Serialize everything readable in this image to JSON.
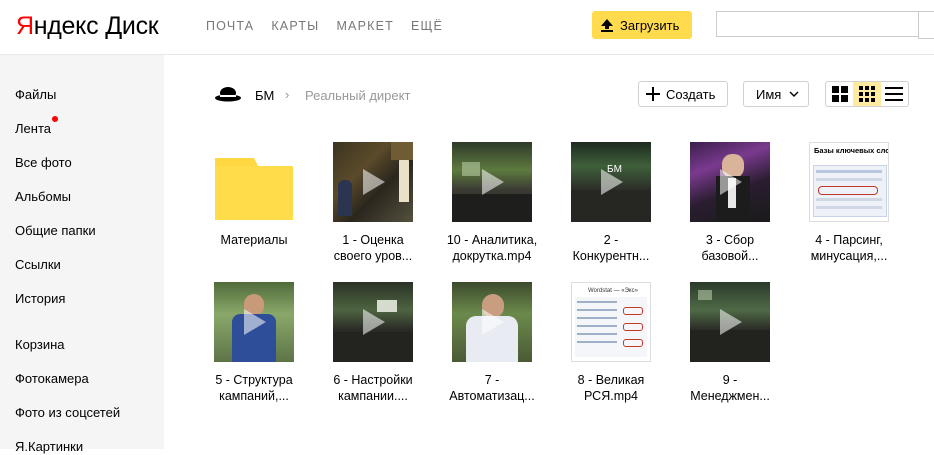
{
  "header": {
    "logo_ya_first": "Я",
    "logo_ya_rest": "ндекс",
    "logo_disk": "Диск",
    "services": [
      "ПОЧТА",
      "КАРТЫ",
      "МАРКЕТ",
      "ЕЩЁ"
    ],
    "upload_label": "Загрузить",
    "search_value": ""
  },
  "sidebar": {
    "items": [
      {
        "label": "Файлы"
      },
      {
        "label": "Лента"
      },
      {
        "label": "Все фото"
      },
      {
        "label": "Альбомы"
      },
      {
        "label": "Общие папки"
      },
      {
        "label": "Ссылки"
      },
      {
        "label": "История"
      },
      {
        "label": "Корзина"
      },
      {
        "label": "Фотокамера"
      },
      {
        "label": "Фото из соцсетей"
      },
      {
        "label": "Я.Картинки"
      }
    ]
  },
  "toolbar": {
    "breadcrumb_root": "БМ",
    "breadcrumb_sep": "›",
    "breadcrumb_current": "Реальный директ",
    "create_label": "Создать",
    "sort_label": "Имя"
  },
  "files": [
    {
      "name": "Материалы",
      "kind": "folder"
    },
    {
      "name": "1 - Оценка\nсвоего уров...",
      "kind": "video"
    },
    {
      "name": "10 - Аналитика,\nдокрутка.mp4",
      "kind": "video"
    },
    {
      "name": "2 -\nКонкурентн...",
      "kind": "video"
    },
    {
      "name": "3 - Сбор\nбазовой...",
      "kind": "video"
    },
    {
      "name": "4 - Парсинг,\nминусация,...",
      "kind": "video"
    },
    {
      "name": "5 - Структура\nкампаний,...",
      "kind": "video"
    },
    {
      "name": "6 - Настройки\nкампании....",
      "kind": "video"
    },
    {
      "name": "7 -\nАвтоматизац...",
      "kind": "video"
    },
    {
      "name": "8 - Великая\nРСЯ.mp4",
      "kind": "video"
    },
    {
      "name": "9 -\nМенеджмен...",
      "kind": "video"
    }
  ],
  "thumb_texts": {
    "t4_heading": "Базы ключевых слов",
    "t8_heading": "Wordstat — «Экс»",
    "t3_overlay": "БМ"
  },
  "colors": {
    "accent_yellow": "#ffdb4d",
    "logo_red": "#ff0000",
    "folder_yellow": "#ffd740",
    "view_active": "#ffeba0"
  }
}
